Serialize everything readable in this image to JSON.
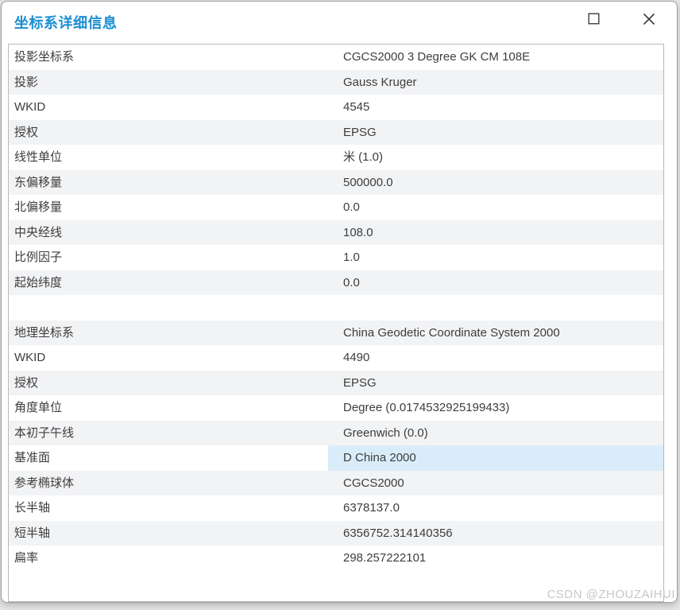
{
  "window": {
    "title": "坐标系详细信息",
    "controls": {
      "maximize_icon": "maximize",
      "close_icon": "close"
    }
  },
  "colors": {
    "accent": "#1b8ed2",
    "alt_row": "#f2f3f5",
    "selected_cell": "#d9ecf9",
    "text": "#3d3d3d",
    "watermark": "#c7c7c7"
  },
  "table": {
    "rows": [
      {
        "label": "投影坐标系",
        "value": "CGCS2000 3 Degree GK CM 108E",
        "alt": false
      },
      {
        "label": "投影",
        "value": "Gauss Kruger",
        "alt": true
      },
      {
        "label": "WKID",
        "value": "4545",
        "alt": false
      },
      {
        "label": "授权",
        "value": "EPSG",
        "alt": true
      },
      {
        "label": "线性单位",
        "value": "米 (1.0)",
        "alt": false
      },
      {
        "label": "东偏移量",
        "value": "500000.0",
        "alt": true
      },
      {
        "label": "北偏移量",
        "value": "0.0",
        "alt": false
      },
      {
        "label": "中央经线",
        "value": "108.0",
        "alt": true
      },
      {
        "label": "比例因子",
        "value": "1.0",
        "alt": false
      },
      {
        "label": "起始纬度",
        "value": "0.0",
        "alt": true
      },
      {
        "spacer": true
      },
      {
        "label": "地理坐标系",
        "value": "China Geodetic Coordinate System 2000",
        "alt": true
      },
      {
        "label": "WKID",
        "value": "4490",
        "alt": false
      },
      {
        "label": "授权",
        "value": "EPSG",
        "alt": true
      },
      {
        "label": "角度单位",
        "value": "Degree (0.0174532925199433)",
        "alt": false
      },
      {
        "label": "本初子午线",
        "value": "Greenwich (0.0)",
        "alt": true
      },
      {
        "label": "基准面",
        "value": "D China 2000",
        "alt": false,
        "selected": true
      },
      {
        "label": "参考椭球体",
        "value": "CGCS2000",
        "alt": true
      },
      {
        "label": "长半轴",
        "value": "6378137.0",
        "alt": false
      },
      {
        "label": "短半轴",
        "value": "6356752.314140356",
        "alt": true
      },
      {
        "label": "扁率",
        "value": "298.257222101",
        "alt": false
      }
    ]
  },
  "watermark": "CSDN @ZHOUZAIHUI"
}
